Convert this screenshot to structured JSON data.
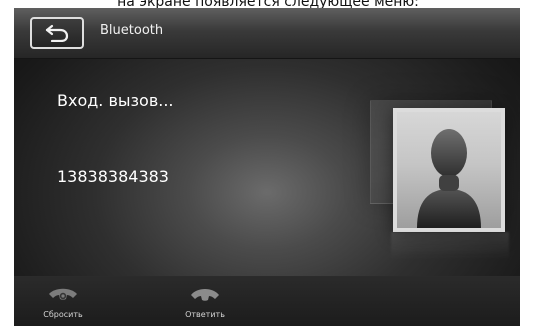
{
  "caption": {
    "text": "на экране появляется следующее меню:"
  },
  "header": {
    "title": "Bluetooth",
    "back_icon": "return-arrow-icon"
  },
  "call": {
    "status": "Вход. вызов...",
    "number": "13838384383",
    "avatar_icon": "contact-placeholder-icon"
  },
  "actions": {
    "decline": {
      "label": "Сбросить",
      "icon": "hang-up-phone-icon"
    },
    "answer": {
      "label": "Ответить",
      "icon": "answer-phone-icon"
    }
  },
  "colors": {
    "header_text": "#f1f1f1",
    "body_text": "#ffffff",
    "label_text": "#d4d4d4",
    "avatar_frame": "#dcdcdc"
  }
}
